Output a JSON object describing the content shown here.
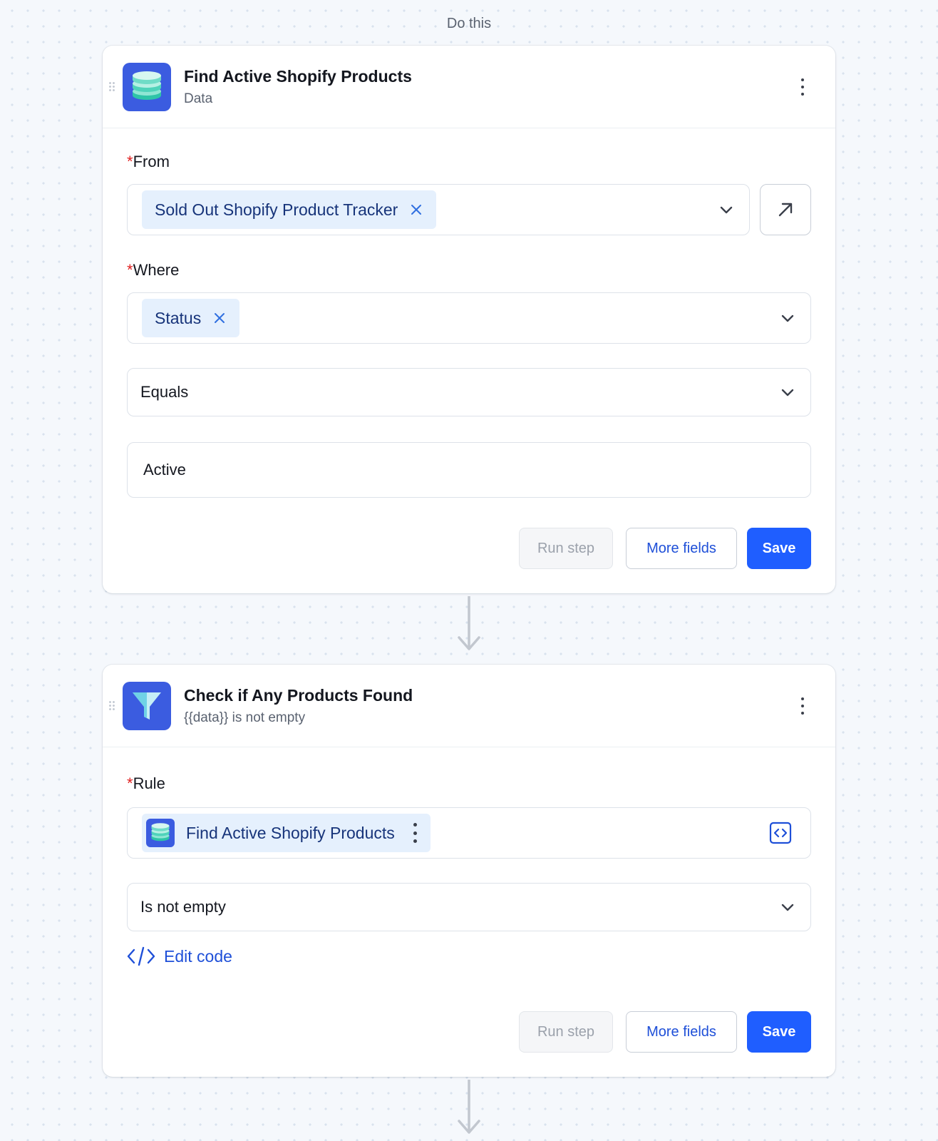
{
  "section_label": "Do this",
  "step1": {
    "title": "Find Active Shopify Products",
    "subtitle": "Data",
    "icon": "database-icon",
    "from": {
      "label": "From",
      "chip": "Sold Out Shopify Product Tracker"
    },
    "where": {
      "label": "Where",
      "chip": "Status",
      "operator": "Equals",
      "value": "Active"
    },
    "buttons": {
      "run": "Run step",
      "more": "More fields",
      "save": "Save"
    }
  },
  "step2": {
    "title": "Check if Any Products Found",
    "subtitle": "{{data}} is not empty",
    "icon": "filter-icon",
    "rule": {
      "label": "Rule",
      "chip": "Find Active Shopify Products",
      "condition": "Is not empty"
    },
    "edit_code": "Edit code",
    "buttons": {
      "run": "Run step",
      "more": "More fields",
      "save": "Save"
    }
  },
  "required_marker": "*",
  "colors": {
    "accent": "#1f5eff",
    "icon_bg": "#3b5ce0",
    "chip_bg": "#e5f0fd",
    "required": "#e02020"
  }
}
